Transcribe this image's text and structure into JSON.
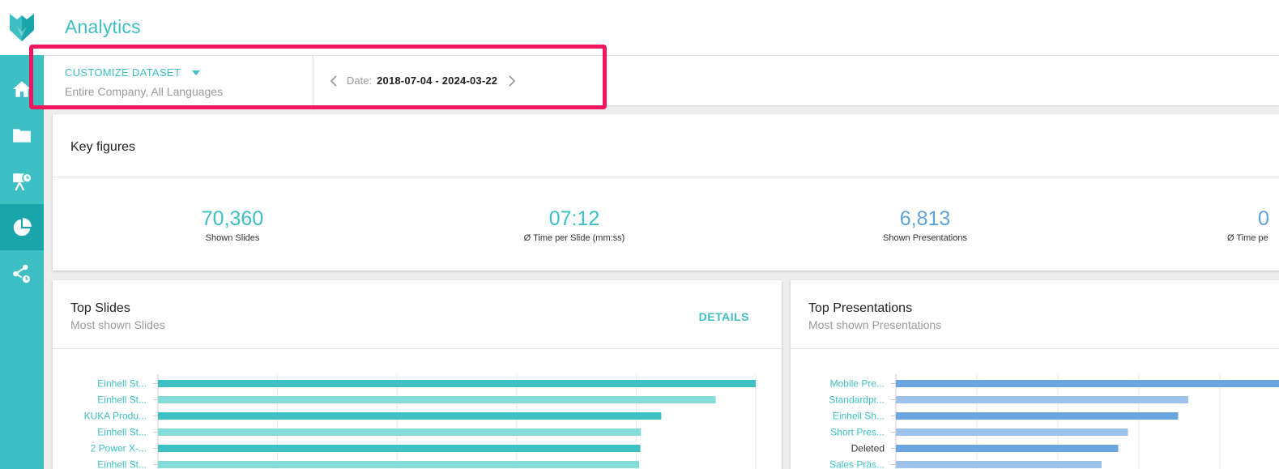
{
  "header": {
    "title": "Analytics"
  },
  "sidebar": {
    "items": [
      {
        "name": "home-icon",
        "active": false
      },
      {
        "name": "folder-icon",
        "active": false
      },
      {
        "name": "presentation-schedule-icon",
        "active": false
      },
      {
        "name": "pie-chart-icon",
        "active": true
      },
      {
        "name": "share-schedule-icon",
        "active": false
      }
    ]
  },
  "filter": {
    "dataset_label": "CUSTOMIZE DATASET",
    "dataset_scope": "Entire Company, All Languages",
    "date_label": "Date:",
    "date_value": "2018-07-04 - 2024-03-22"
  },
  "key_figures": {
    "title": "Key figures",
    "items": [
      {
        "value": "70,360",
        "label": "Shown Slides"
      },
      {
        "value": "07:12",
        "label": "Ø Time per Slide (mm:ss)"
      },
      {
        "value": "6,813",
        "label": "Shown Presentations"
      },
      {
        "value": "0",
        "label": "Ø Time pe"
      }
    ]
  },
  "top_slides": {
    "title": "Top Slides",
    "subtitle": "Most shown Slides",
    "details_label": "DETAILS"
  },
  "top_presentations": {
    "title": "Top Presentations",
    "subtitle": "Most shown Presentations"
  },
  "colors": {
    "accent": "#3dbfc4",
    "accent_light": "#84ddd8",
    "blue": "#6aa5e0",
    "blue_light": "#9cc2ea",
    "highlight": "#f2165e"
  },
  "chart_data": [
    {
      "type": "bar",
      "orientation": "horizontal",
      "categories": [
        "Einhell St...",
        "Einhell St...",
        "KUKA Produ...",
        "Einhell St...",
        "2 Power X-...",
        "Einhell St..."
      ],
      "values": [
        1000,
        933,
        842,
        808,
        807,
        805
      ],
      "xlim": [
        0,
        1000
      ],
      "grid": true
    },
    {
      "type": "bar",
      "orientation": "horizontal",
      "categories": [
        "Mobile Pre...",
        "Standardpr...",
        "Einhell Sh...",
        "Short Pres...",
        "Deleted",
        "Sales Präs..."
      ],
      "values": [
        1000,
        722,
        697,
        573,
        549,
        508
      ],
      "xlim": [
        0,
        1000
      ],
      "grid": true
    }
  ]
}
